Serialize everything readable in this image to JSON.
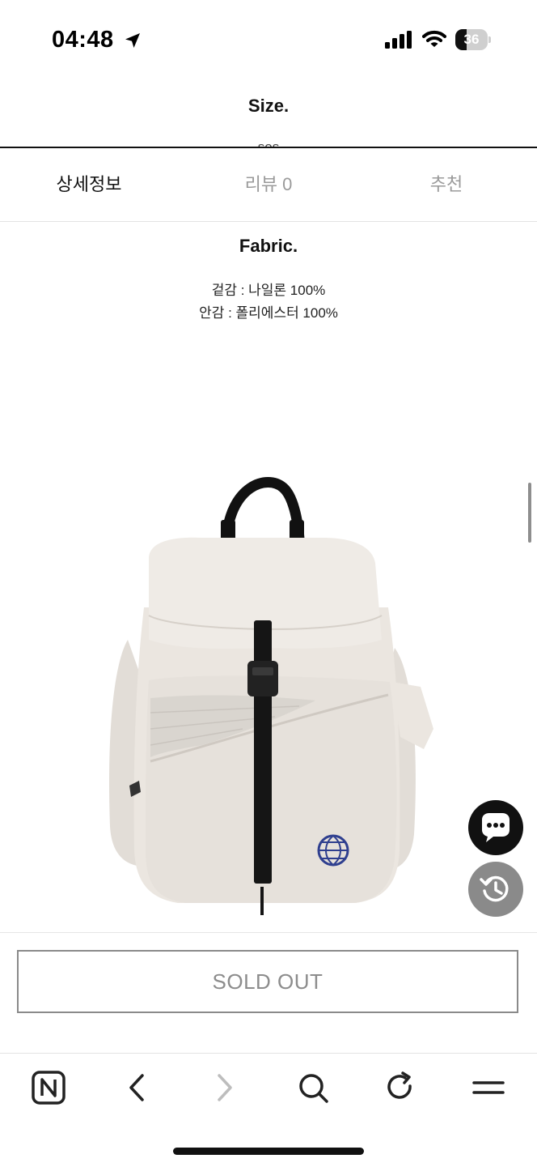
{
  "status_bar": {
    "time": "04:48",
    "battery_level": "36",
    "battery_fraction": 0.36,
    "icons": [
      "location-arrow-icon",
      "cellular-signal-icon",
      "wifi-icon",
      "battery-icon"
    ]
  },
  "size_section": {
    "title": "Size.",
    "value": "sos"
  },
  "tabs": [
    {
      "label": "상세정보",
      "active": true
    },
    {
      "label": "리뷰 0",
      "active": false
    },
    {
      "label": "추천",
      "active": false
    }
  ],
  "fabric": {
    "title": "Fabric.",
    "outer": "겉감 : 나일론 100%",
    "lining": "안감 : 폴리에스터 100%"
  },
  "product_image": {
    "description_icon": "backpack-image"
  },
  "floating": {
    "chat_icon": "chat-bubble-icon",
    "history_icon": "recent-history-icon"
  },
  "purchase": {
    "sold_out_label": "SOLD OUT"
  },
  "toolbar": {
    "icons": [
      "naver-home-icon",
      "back-icon",
      "forward-icon",
      "search-icon",
      "refresh-icon",
      "menu-icon"
    ]
  },
  "colors": {
    "text_primary": "#111111",
    "text_muted": "#9a9a9a",
    "sold_out_border": "#8a8a8a",
    "chat_fab": "#111111",
    "history_fab": "#8a8a8a"
  }
}
